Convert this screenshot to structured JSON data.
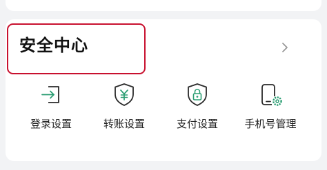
{
  "security_center": {
    "title": "安全中心",
    "actions": [
      {
        "label": "登录设置",
        "icon": "login-icon"
      },
      {
        "label": "转账设置",
        "icon": "yuan-shield-icon"
      },
      {
        "label": "支付设置",
        "icon": "lock-shield-icon"
      },
      {
        "label": "手机号管理",
        "icon": "phone-settings-icon"
      }
    ]
  },
  "colors": {
    "accent": "#2a9d72",
    "highlight_border": "#c8102e",
    "background": "#f2f3f5",
    "card": "#ffffff"
  }
}
